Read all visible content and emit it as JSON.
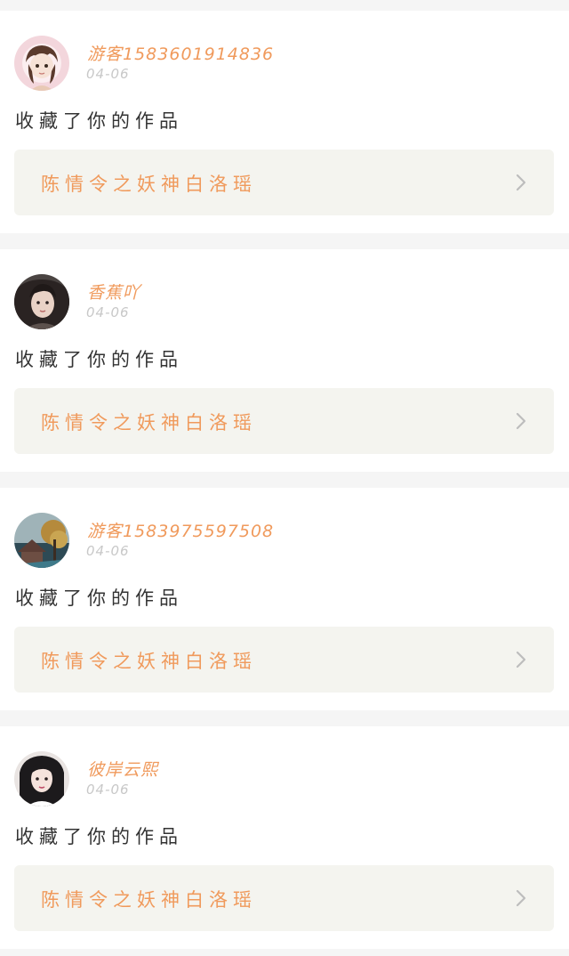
{
  "notifications": [
    {
      "username": "游客15836019148​36",
      "date": "04-06",
      "action": "收藏了你的作品",
      "work_title": "陈情令之妖神白洛瑶",
      "avatar_icon": "avatar-girl-illustration"
    },
    {
      "username": "香蕉吖",
      "date": "04-06",
      "action": "收藏了你的作品",
      "work_title": "陈情令之妖神白洛瑶",
      "avatar_icon": "avatar-woman-photo"
    },
    {
      "username": "游客1583975597508",
      "date": "04-06",
      "action": "收藏了你的作品",
      "work_title": "陈情令之妖神白洛瑶",
      "avatar_icon": "avatar-landscape-photo"
    },
    {
      "username": "彼岸云熙",
      "date": "04-06",
      "action": "收藏了你的作品",
      "work_title": "陈情令之妖神白洛瑶",
      "avatar_icon": "avatar-woman-photo"
    }
  ],
  "colors": {
    "accent": "#f09a5c",
    "card_bg": "#f4f4ef",
    "page_bg": "#f5f5f5"
  }
}
